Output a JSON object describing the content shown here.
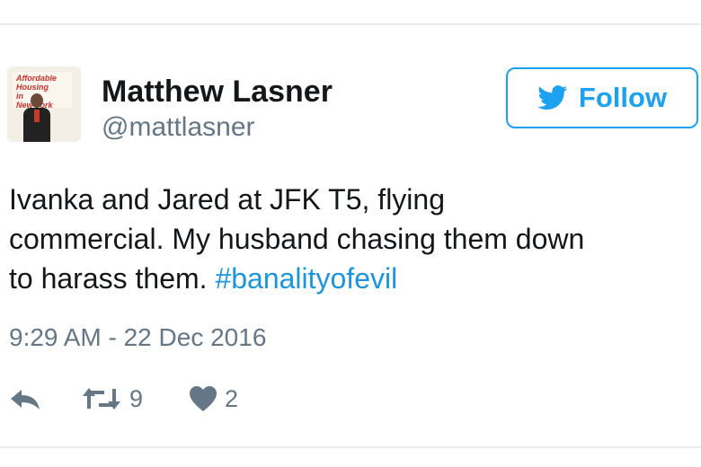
{
  "user": {
    "name": "Matthew Lasner",
    "handle": "@mattlasner",
    "avatar_caption": "Affordable\nHousing\nin\nNew York",
    "avatar_icon": "profile-photo"
  },
  "follow_button": {
    "label": "Follow",
    "icon": "twitter-bird-icon",
    "color": "#1da1f2"
  },
  "tweet": {
    "line1": "Ivanka and Jared at JFK T5, flying",
    "line2": "commercial. My husband chasing them down",
    "line3_text": "to harass them. ",
    "hashtag": "#banalityofevil",
    "timestamp": "9:29 AM - 22 Dec 2016"
  },
  "actions": {
    "reply": {
      "icon": "reply-icon"
    },
    "retweet": {
      "icon": "retweet-icon",
      "count": "9"
    },
    "like": {
      "icon": "heart-icon",
      "count": "2"
    }
  },
  "colors": {
    "text": "#14171a",
    "secondary": "#657786",
    "link": "#1b95e0",
    "divider": "#e6ecf0"
  }
}
